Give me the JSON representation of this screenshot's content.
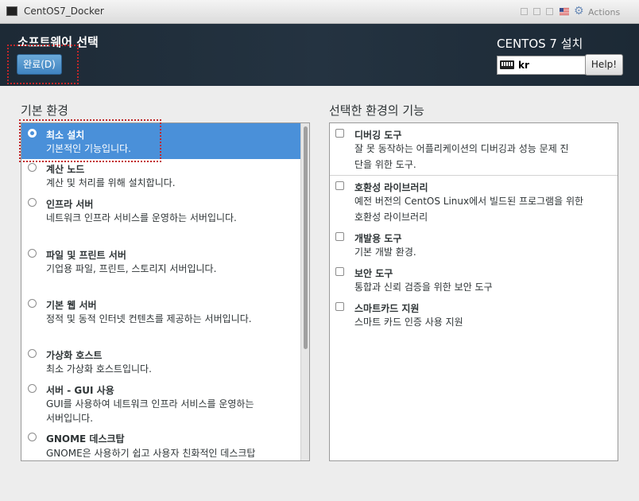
{
  "window": {
    "title": "CentOS7_Docker",
    "actions_label": "Actions"
  },
  "header": {
    "title": "소프트웨어 선택",
    "done_label": "완료(D)",
    "install_title": "CENTOS 7 설치",
    "keyboard_layout": "kr",
    "help_label": "Help!"
  },
  "base_environment": {
    "section_title": "기본 환경",
    "items": [
      {
        "title": "최소 설치",
        "desc": [
          "기본적인 기능입니다."
        ],
        "selected": true
      },
      {
        "title": "계산 노드",
        "desc": [
          "계산 및 처리를 위해 설치합니다."
        ],
        "selected": false
      },
      {
        "title": "인프라 서버",
        "desc": [
          "네트워크 인프라 서비스를 운영하는 서버입니다."
        ],
        "selected": false
      },
      {
        "title": "파일 및 프린트 서버",
        "desc": [
          "기업용 파일, 프린트, 스토리지 서버입니다."
        ],
        "selected": false
      },
      {
        "title": "기본 웹 서버",
        "desc": [
          "정적 및 동적 인터넷 컨텐츠를 제공하는 서버입니다."
        ],
        "selected": false
      },
      {
        "title": "가상화 호스트",
        "desc": [
          "최소 가상화 호스트입니다."
        ],
        "selected": false
      },
      {
        "title": "서버 - GUI 사용",
        "desc": [
          "GUI를 사용하여 네트워크 인프라 서비스를 운영하는",
          "서버입니다."
        ],
        "selected": false
      },
      {
        "title": "GNOME 데스크탑",
        "desc": [
          "GNOME은 사용하기 쉽고 사용자 친화적인 데스크탑"
        ],
        "selected": false
      }
    ]
  },
  "addons": {
    "section_title": "선택한 환경의 기능",
    "items": [
      {
        "title": "디버깅 도구",
        "desc": [
          "잘 못 동작하는 어플리케이션의 디버깅과 성능 문제 진",
          "단을 위한 도구."
        ],
        "checked": false
      },
      {
        "title": "호환성 라이브러리",
        "desc": [
          "예전 버전의 CentOS Linux에서 빌드된 프로그램을 위한",
          "호환성 라이브러리"
        ],
        "checked": false
      },
      {
        "title": "개발용 도구",
        "desc": [
          "기본 개발 환경."
        ],
        "checked": false
      },
      {
        "title": "보안 도구",
        "desc": [
          "통합과 신뢰 검증을 위한 보안 도구"
        ],
        "checked": false
      },
      {
        "title": "스마트카드 지원",
        "desc": [
          "스마트 카드 인증 사용 지원"
        ],
        "checked": false
      }
    ]
  },
  "colors": {
    "header_bg": "#1d2a36",
    "selection": "#4a90d9",
    "annotation_box": "#c0282a"
  }
}
